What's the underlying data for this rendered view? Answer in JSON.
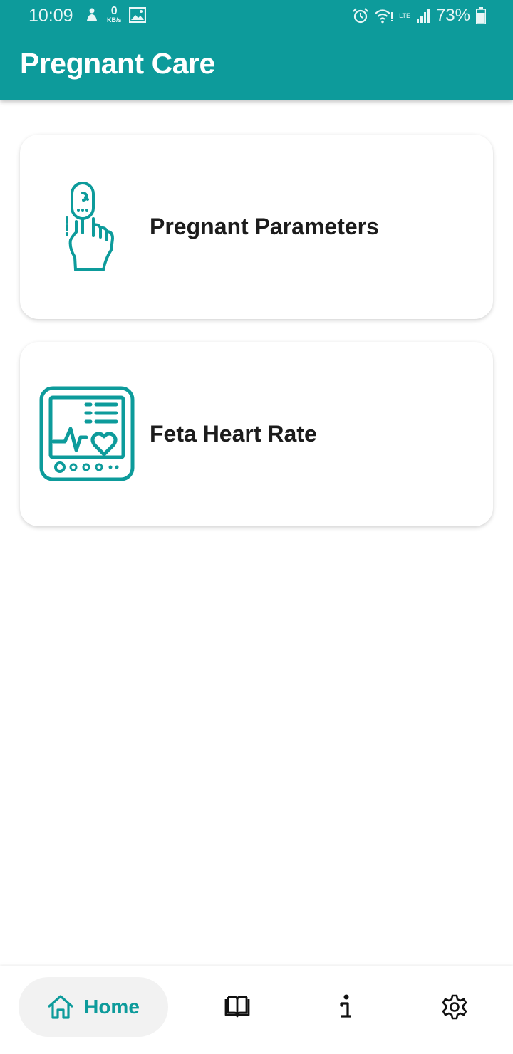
{
  "status_bar": {
    "time": "10:09",
    "net_speed_value": "0",
    "net_speed_unit": "KB/s",
    "lte_label": "LTE",
    "battery": "73%"
  },
  "header": {
    "title": "Pregnant Care"
  },
  "cards": [
    {
      "label": "Pregnant Parameters",
      "icon": "finger-pulse-oximeter-icon"
    },
    {
      "label": "Feta Heart Rate",
      "icon": "heart-rate-monitor-icon"
    }
  ],
  "bottom_nav": {
    "home_label": "Home",
    "items": [
      "home-icon",
      "book-icon",
      "info-icon",
      "settings-icon"
    ]
  },
  "colors": {
    "primary": "#0d9b9b",
    "card_bg": "#ffffff",
    "nav_pill": "#f2f2f2",
    "text": "#1c1c1c"
  }
}
